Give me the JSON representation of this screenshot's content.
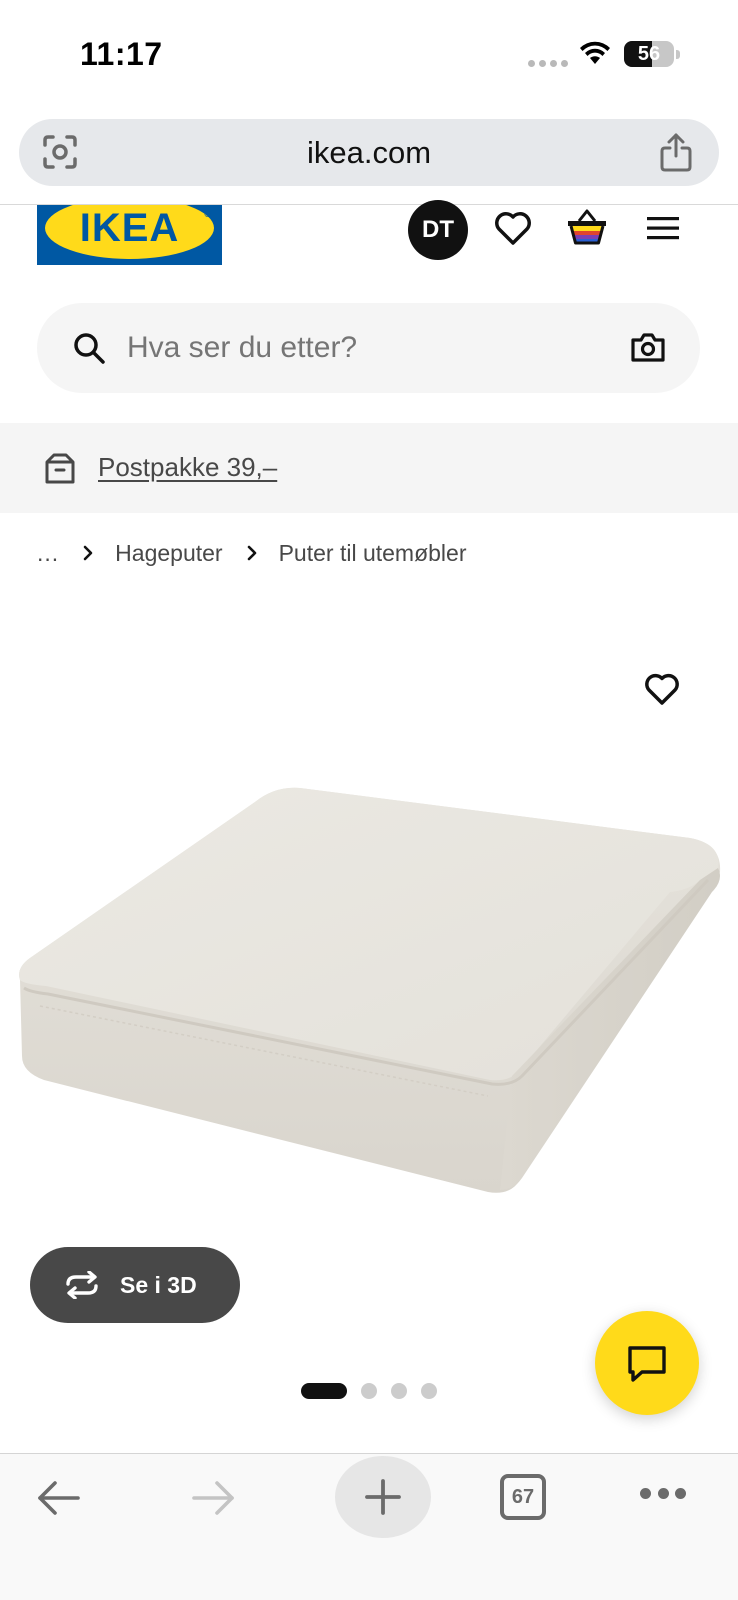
{
  "status_bar": {
    "time": "11:17",
    "battery_percent": "56",
    "battery_level": 0.56
  },
  "browser": {
    "url": "ikea.com",
    "tab_count": "67"
  },
  "header": {
    "logo_text": "IKEA",
    "avatar_initials": "DT"
  },
  "search": {
    "placeholder": "Hva ser du etter?"
  },
  "promo": {
    "link_text": "Postpakke 39,–"
  },
  "breadcrumb": {
    "ellipsis": "...",
    "items": [
      "Hageputer",
      "Puter til utemøbler"
    ]
  },
  "product": {
    "view_3d_label": "Se i 3D",
    "image_count": 4,
    "active_image_index": 0
  },
  "colors": {
    "ikea_blue": "#0058a3",
    "ikea_yellow": "#ffda1a",
    "button_dark": "#484848"
  }
}
